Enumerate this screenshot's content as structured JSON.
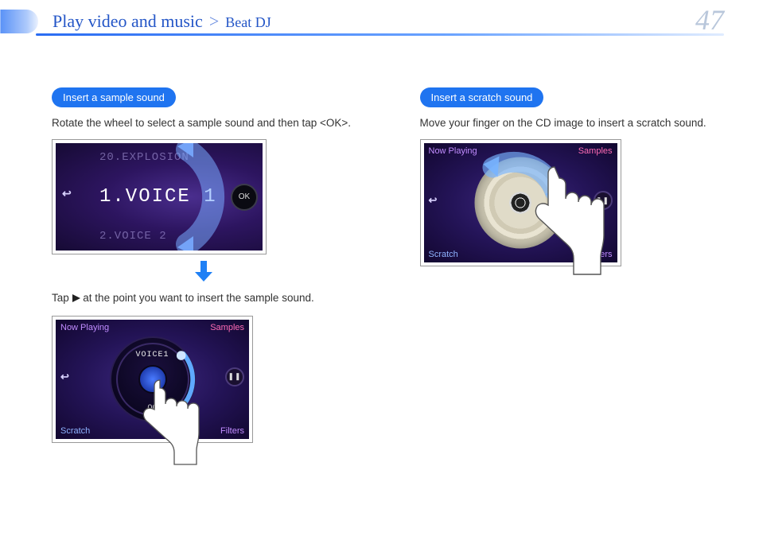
{
  "header": {
    "breadcrumb_main": "Play video and music",
    "breadcrumb_separator": ">",
    "breadcrumb_sub": "Beat DJ",
    "page_number": "47"
  },
  "left": {
    "pill": "Insert a sample sound",
    "instruction1": "Rotate the wheel to select a sample sound and then tap <OK>.",
    "instruction2_prefix": "Tap ",
    "instruction2_suffix": " at the point you want to insert the sample sound.",
    "voice_screen": {
      "back_glyph": "↩",
      "item_above": "20.EXPLOSION",
      "item_selected": "1.VOICE 1",
      "item_below": "2.VOICE 2",
      "ok_label": "OK"
    },
    "dj_screen": {
      "top_left": "Now Playing",
      "top_right": "Samples",
      "bottom_left": "Scratch",
      "bottom_right": "Filters",
      "back_glyph": "↩",
      "pause_glyph": "❚❚",
      "dial_label": "VOICE1",
      "dial_bottom": "00"
    }
  },
  "right": {
    "pill": "Insert a scratch sound",
    "instruction": "Move your finger on the CD image to insert a scratch sound.",
    "dj_screen": {
      "top_left": "Now Playing",
      "top_right": "Samples",
      "bottom_left": "Scratch",
      "bottom_right": "Filters",
      "back_glyph": "↩",
      "pause_glyph": "❚❚"
    }
  }
}
